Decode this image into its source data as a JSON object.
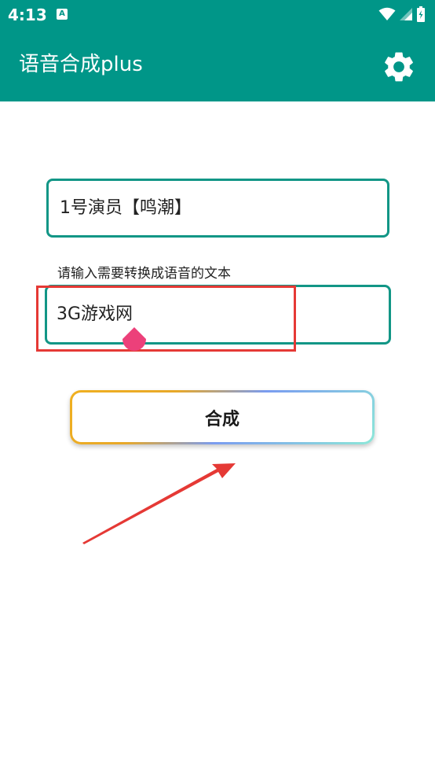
{
  "status_bar": {
    "time": "4:13",
    "notification_icon_letter": "A",
    "icons": [
      "wifi-icon",
      "signal-icon",
      "battery-icon"
    ]
  },
  "app_bar": {
    "title": "语音合成plus",
    "settings_icon": "gear-icon",
    "color": "#009688"
  },
  "voice_selector": {
    "value": "1号演员【鸣潮】"
  },
  "text_input": {
    "label": "请输入需要转换成语音的文本",
    "value": "3G游戏网"
  },
  "synthesize_button": {
    "label": "合成"
  },
  "colors": {
    "accent": "#009688",
    "field_border": "#129686",
    "annotation_red": "#e53935",
    "cursor_handle": "#ec407a"
  }
}
